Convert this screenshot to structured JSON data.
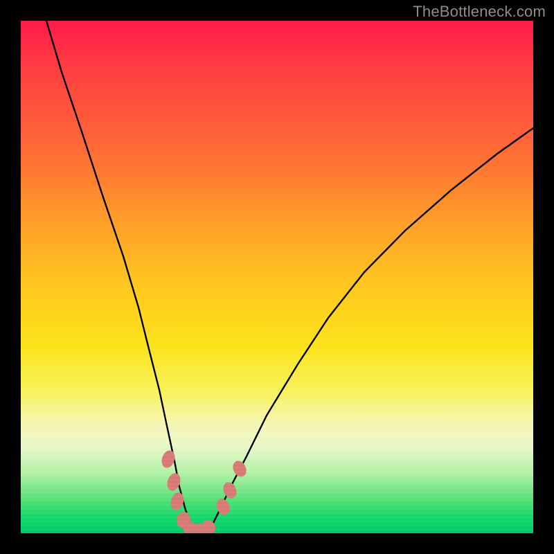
{
  "watermark": "TheBottleneck.com",
  "chart_data": {
    "type": "line",
    "title": "",
    "xlabel": "",
    "ylabel": "",
    "xlim": [
      0,
      100
    ],
    "ylim": [
      0,
      100
    ],
    "background_gradient": {
      "orientation": "vertical",
      "stops": [
        {
          "pos": 0,
          "color": "#ff1a49"
        },
        {
          "pos": 25,
          "color": "#ff6a36"
        },
        {
          "pos": 52,
          "color": "#ffc81f"
        },
        {
          "pos": 72,
          "color": "#f8f25a"
        },
        {
          "pos": 88,
          "color": "#b6f2a8"
        },
        {
          "pos": 100,
          "color": "#00c96a"
        }
      ]
    },
    "series": [
      {
        "name": "bottleneck-curve",
        "color": "#000000",
        "x": [
          5,
          8,
          12,
          16,
          20,
          23,
          25,
          27,
          28.5,
          30,
          31,
          32,
          33,
          34,
          35,
          36,
          37.5,
          39,
          41,
          44,
          48,
          54,
          60,
          67,
          75,
          84,
          93,
          100
        ],
        "y": [
          100,
          90,
          78,
          66,
          54,
          44,
          36,
          28,
          21,
          14,
          9,
          5,
          2,
          0.5,
          0,
          0.5,
          2,
          5,
          9,
          15,
          23,
          33,
          42,
          51,
          59,
          67,
          74,
          79
        ]
      }
    ],
    "markers": [
      {
        "name": "left-cluster",
        "shape": "rounded-pill",
        "color": "#d87a74",
        "points": [
          {
            "x": 28.8,
            "y": 14.5
          },
          {
            "x": 29.8,
            "y": 10.0
          },
          {
            "x": 30.6,
            "y": 6.2
          },
          {
            "x": 31.8,
            "y": 2.6
          },
          {
            "x": 33.3,
            "y": 0.6
          },
          {
            "x": 35.0,
            "y": 0.4
          },
          {
            "x": 36.6,
            "y": 1.1
          }
        ]
      },
      {
        "name": "right-cluster",
        "shape": "rounded-pill",
        "color": "#d87a74",
        "points": [
          {
            "x": 39.4,
            "y": 5.2
          },
          {
            "x": 40.8,
            "y": 8.4
          },
          {
            "x": 42.7,
            "y": 12.5
          }
        ]
      }
    ]
  }
}
